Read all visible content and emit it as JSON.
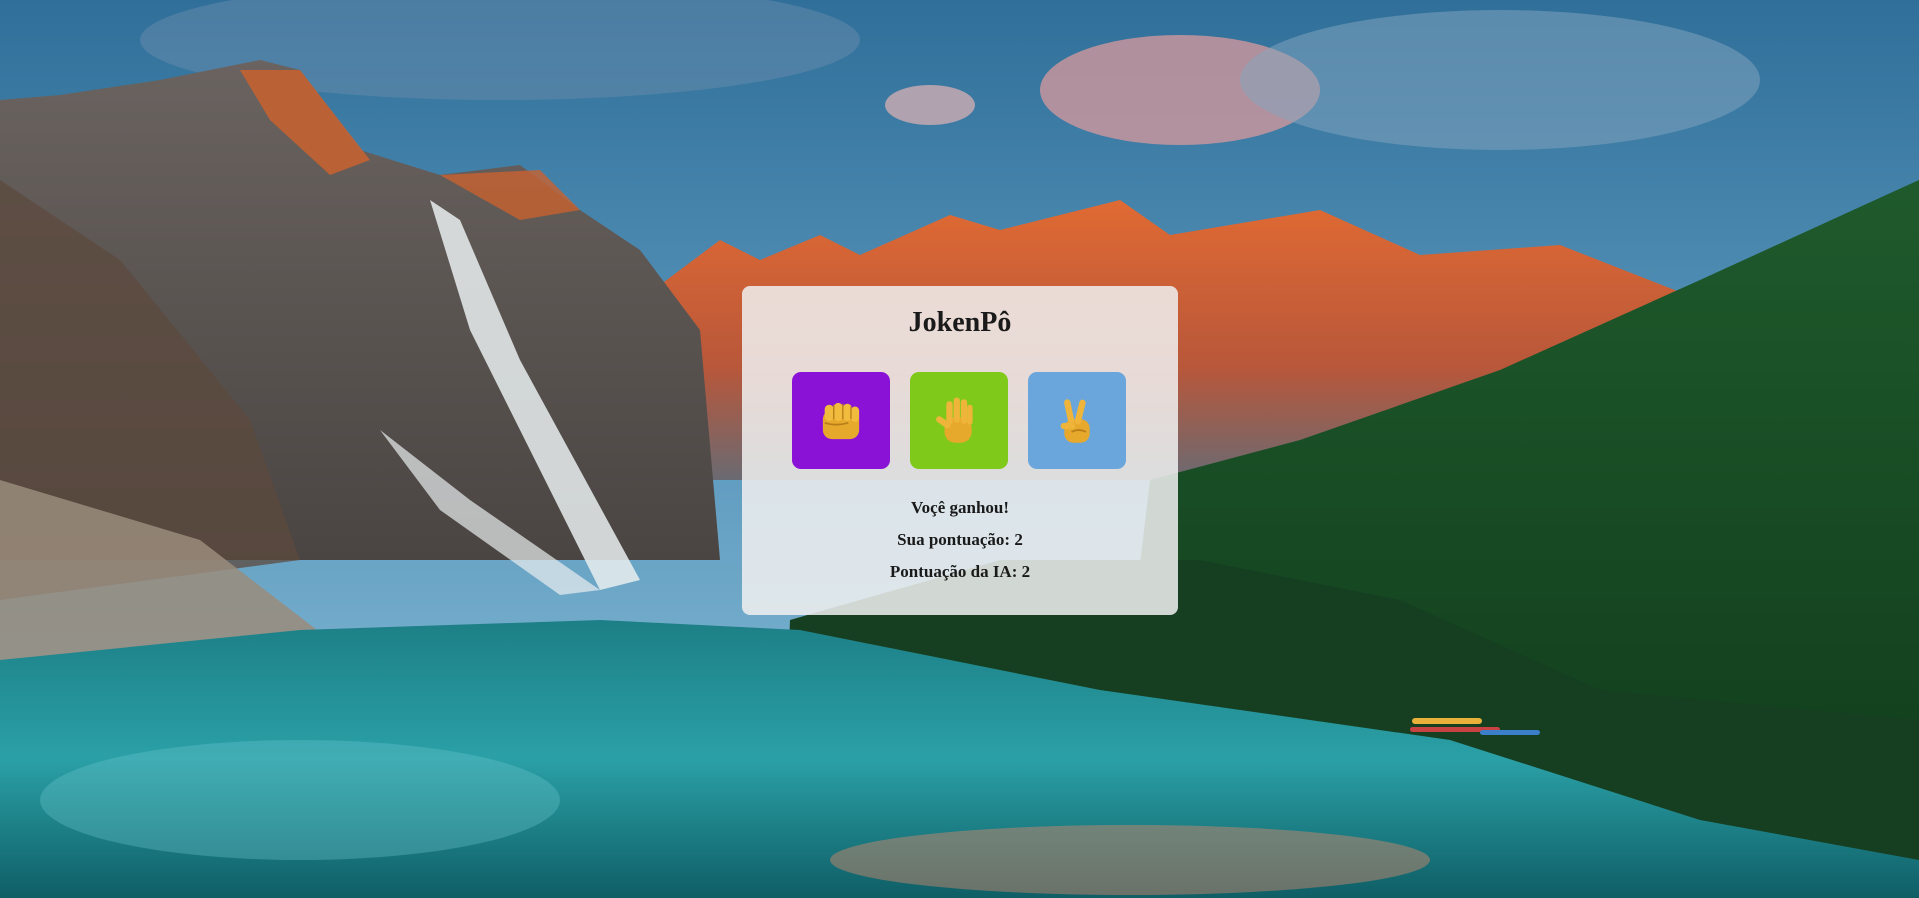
{
  "game": {
    "title": "JokenPô",
    "choices": [
      {
        "name": "pedra",
        "icon": "fist-icon",
        "color": "#8a12d6"
      },
      {
        "name": "papel",
        "icon": "open-hand-icon",
        "color": "#7ec91a"
      },
      {
        "name": "tesoura",
        "icon": "victory-hand-icon",
        "color": "#6aa6dc"
      }
    ],
    "result_text": "Voçê ganhou!",
    "player_score_text": "Sua pontuação: 2",
    "ai_score_text": "Pontuação da IA: 2"
  },
  "colors": {
    "panel_bg": "#f0f0f0",
    "emoji_yellow": "#e7a92c"
  }
}
